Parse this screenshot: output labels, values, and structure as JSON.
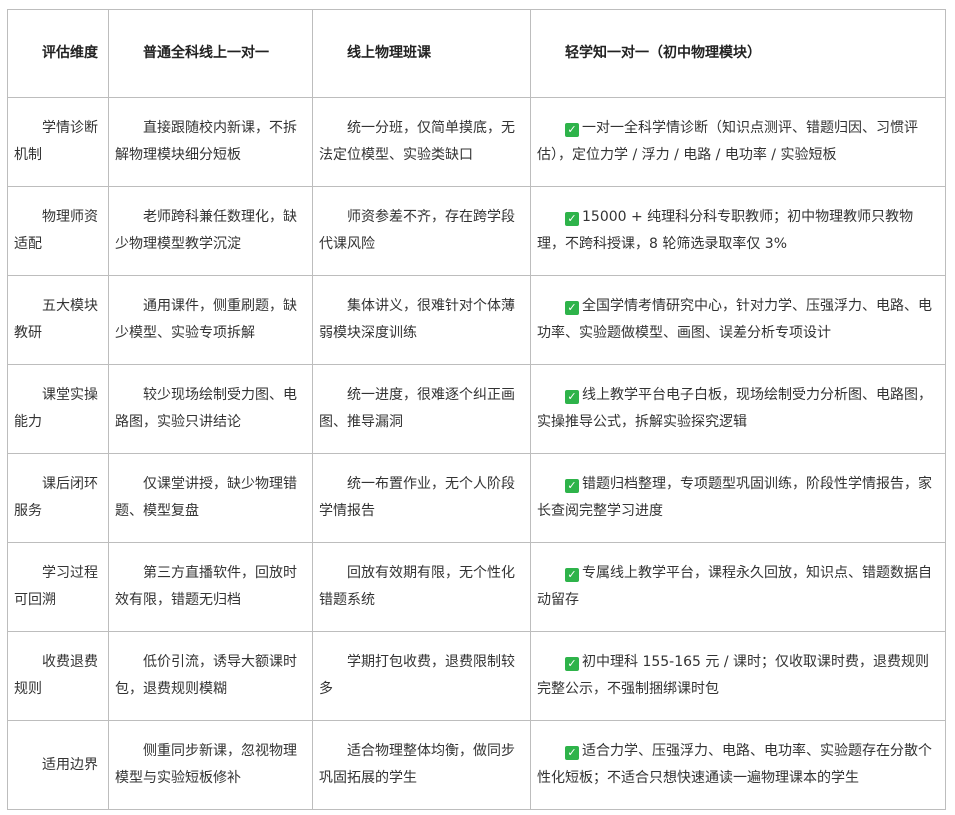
{
  "table": {
    "headers": [
      "评估维度",
      "普通全科线上一对一",
      "线上物理班课",
      "轻学知一对一（初中物理模块）"
    ],
    "check_icon": "check-mark-icon",
    "check_color": "#2eb34a",
    "rows": [
      {
        "dimension": "学情诊断机制",
        "general": "直接跟随校内新课，不拆解物理模块细分短板",
        "class_course": "统一分班，仅简单摸底，无法定位模型、实验类缺口",
        "qingxuezhi": "一对一全科学情诊断（知识点测评、错题归因、习惯评估），定位力学 / 浮力 / 电路 / 电功率 / 实验短板"
      },
      {
        "dimension": "物理师资适配",
        "general": "老师跨科兼任数理化，缺少物理模型教学沉淀",
        "class_course": "师资参差不齐，存在跨学段代课风险",
        "qingxuezhi": "15000 + 纯理科分科专职教师；初中物理教师只教物理，不跨科授课，8 轮筛选录取率仅 3%"
      },
      {
        "dimension": "五大模块教研",
        "general": "通用课件，侧重刷题，缺少模型、实验专项拆解",
        "class_course": "集体讲义，很难针对个体薄弱模块深度训练",
        "qingxuezhi": "全国学情考情研究中心，针对力学、压强浮力、电路、电功率、实验题做模型、画图、误差分析专项设计"
      },
      {
        "dimension": "课堂实操能力",
        "general": "较少现场绘制受力图、电路图，实验只讲结论",
        "class_course": "统一进度，很难逐个纠正画图、推导漏洞",
        "qingxuezhi": "线上教学平台电子白板，现场绘制受力分析图、电路图，实操推导公式，拆解实验探究逻辑"
      },
      {
        "dimension": "课后闭环服务",
        "general": "仅课堂讲授，缺少物理错题、模型复盘",
        "class_course": "统一布置作业，无个人阶段学情报告",
        "qingxuezhi": "错题归档整理，专项题型巩固训练，阶段性学情报告，家长查阅完整学习进度"
      },
      {
        "dimension": "学习过程可回溯",
        "general": "第三方直播软件，回放时效有限，错题无归档",
        "class_course": "回放有效期有限，无个性化错题系统",
        "qingxuezhi": "专属线上教学平台，课程永久回放，知识点、错题数据自动留存"
      },
      {
        "dimension": "收费退费规则",
        "general": "低价引流，诱导大额课时包，退费规则模糊",
        "class_course": "学期打包收费，退费限制较多",
        "qingxuezhi": "初中理科 155-165 元 / 课时；仅收取课时费，退费规则完整公示，不强制捆绑课时包"
      },
      {
        "dimension": "适用边界",
        "general": "侧重同步新课，忽视物理模型与实验短板修补",
        "class_course": "适合物理整体均衡，做同步巩固拓展的学生",
        "qingxuezhi": "适合力学、压强浮力、电路、电功率、实验题存在分散个性化短板；不适合只想快速通读一遍物理课本的学生"
      }
    ]
  }
}
